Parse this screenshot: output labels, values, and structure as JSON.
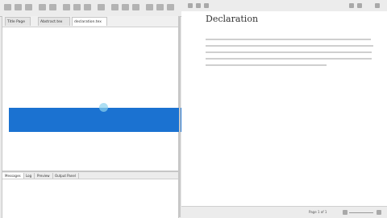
{
  "editor": {
    "tabs": [
      {
        "label": "Title Page"
      },
      {
        "label": "Abstract.tex"
      },
      {
        "label": "declaration.tex"
      }
    ]
  },
  "preview": {
    "heading": "Declaration"
  },
  "bottom_panel": {
    "tabs": [
      {
        "label": "Messages"
      },
      {
        "label": "Log"
      },
      {
        "label": "Preview"
      },
      {
        "label": "Output Panel"
      }
    ]
  },
  "status": {
    "page": "Page 1 of 1"
  },
  "colors": {
    "selection": "#1b72d1",
    "editor_bg": "#ffffff",
    "toolbar_bg": "#ececec"
  }
}
